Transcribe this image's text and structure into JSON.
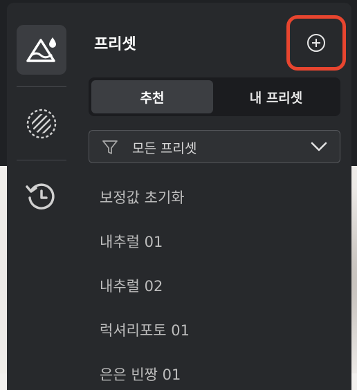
{
  "panel": {
    "title": "프리셋"
  },
  "tabs": [
    {
      "label": "추천",
      "active": true
    },
    {
      "label": "내 프리셋",
      "active": false
    }
  ],
  "filter": {
    "label": "모든 프리셋",
    "icon": "filter-icon"
  },
  "presets": [
    "보정값 초기화",
    "내추럴 01",
    "내추럴 02",
    "럭셔리포토 01",
    "은은 빈짱 01"
  ],
  "rail": {
    "icons": [
      "preset-image-icon",
      "texture-circle-icon",
      "history-icon"
    ]
  },
  "colors": {
    "panel_bg": "#27292c",
    "highlight_border": "#e8452f"
  }
}
